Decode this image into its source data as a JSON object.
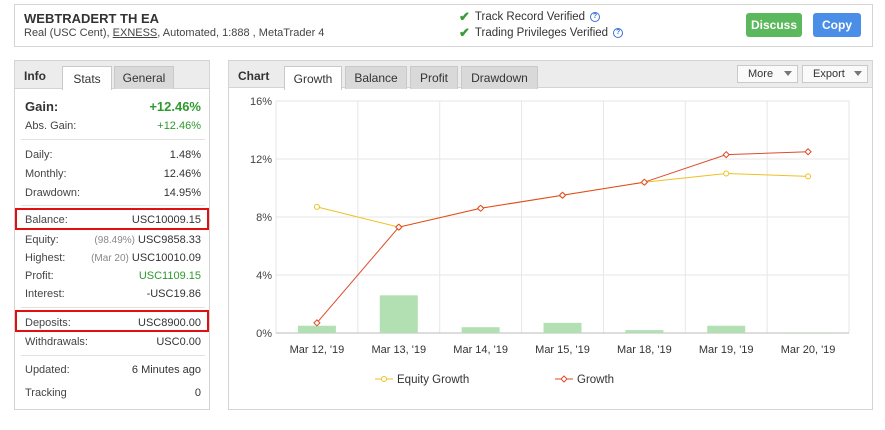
{
  "header": {
    "system_name": "WEBTRADERT TH EA",
    "meta_prefix": "Real (USC Cent),",
    "broker": "EXNESS",
    "meta_suffix": ", Automated, 1:888 , MetaTrader 4",
    "track_record": "Track Record Verified",
    "trading_privileges": "Trading Privileges Verified",
    "discuss_label": "Discuss",
    "copy_label": "Copy"
  },
  "info_panel": {
    "title": "Info",
    "tabs": [
      "Stats",
      "General"
    ],
    "active_tab": "Stats",
    "gain": {
      "label": "Gain:",
      "value": "+12.46%"
    },
    "abs_gain": {
      "label": "Abs. Gain:",
      "value": "+12.46%"
    },
    "daily": {
      "label": "Daily:",
      "value": "1.48%"
    },
    "monthly": {
      "label": "Monthly:",
      "value": "12.46%"
    },
    "drawdown": {
      "label": "Drawdown:",
      "value": "14.95%"
    },
    "balance": {
      "label": "Balance:",
      "value": "USC10009.15"
    },
    "equity": {
      "label": "Equity:",
      "note": "(98.49%)",
      "value": "USC9858.33"
    },
    "highest": {
      "label": "Highest:",
      "note": "(Mar 20)",
      "value": "USC10010.09"
    },
    "profit": {
      "label": "Profit:",
      "value": "USC1109.15"
    },
    "interest": {
      "label": "Interest:",
      "value": "-USC19.86"
    },
    "deposits": {
      "label": "Deposits:",
      "value": "USC8900.00"
    },
    "withdrawals": {
      "label": "Withdrawals:",
      "value": "USC0.00"
    },
    "updated": {
      "label": "Updated:",
      "value": "6 Minutes ago"
    },
    "tracking": {
      "label": "Tracking",
      "value": "0"
    },
    "highlight_color": "#e01010",
    "positive_color": "#2e9a2e"
  },
  "chart_panel": {
    "title": "Chart",
    "tabs": [
      "Growth",
      "Balance",
      "Profit",
      "Drawdown"
    ],
    "active_tab": "Growth",
    "more_label": "More",
    "export_label": "Export"
  },
  "chart_data": {
    "type": "line",
    "categories": [
      "Mar 12, '19",
      "Mar 13, '19",
      "Mar 14, '19",
      "Mar 15, '19",
      "Mar 18, '19",
      "Mar 19, '19",
      "Mar 20, '19"
    ],
    "y_ticks": [
      "0%",
      "4%",
      "8%",
      "12%",
      "16%"
    ],
    "ylim": [
      0,
      16
    ],
    "grid": true,
    "legend_position": "bottom",
    "series": [
      {
        "name": "Equity Growth",
        "color": "#f0c020",
        "values": [
          8.7,
          7.3,
          8.6,
          9.5,
          10.4,
          11.0,
          10.8
        ]
      },
      {
        "name": "Growth",
        "color": "#e04a2a",
        "values": [
          0.7,
          7.3,
          8.6,
          9.5,
          10.4,
          12.3,
          12.5
        ]
      }
    ],
    "bars": {
      "color": "#b3e0b3",
      "values": [
        0.5,
        2.6,
        0.4,
        0.7,
        0.2,
        0.5,
        0.05
      ]
    }
  }
}
